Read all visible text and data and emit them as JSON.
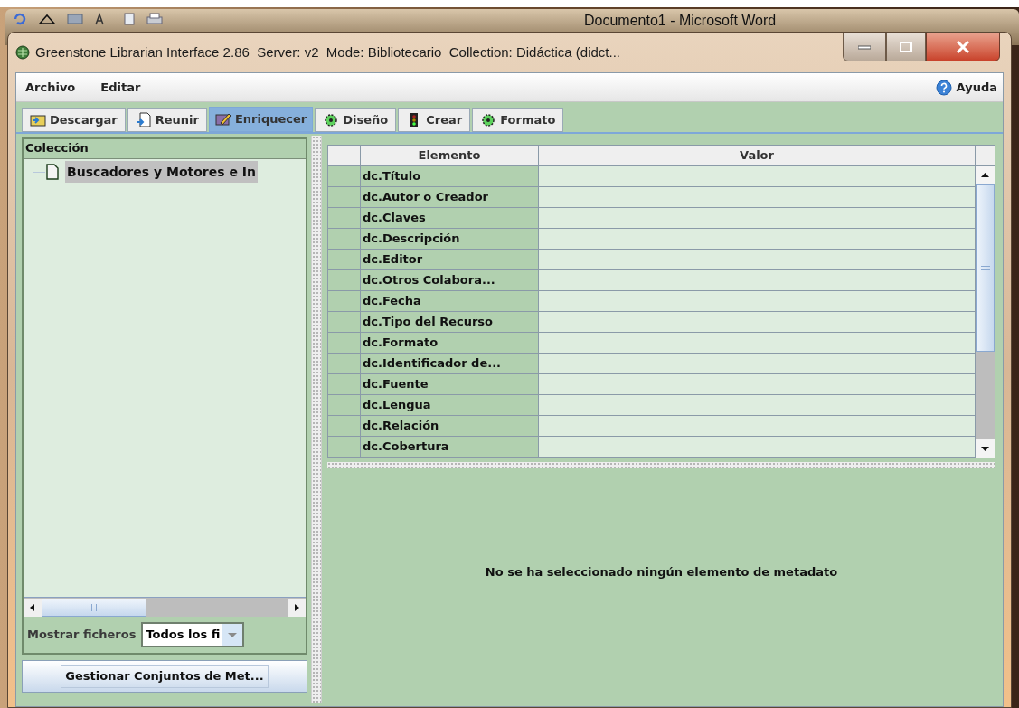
{
  "background_window": {
    "title": "Documento1 - Microsoft Word"
  },
  "window": {
    "title": "Greenstone Librarian Interface 2.86  Server: v2  Mode: Bibliotecario  Collection: Didáctica (didct..."
  },
  "menu": [
    {
      "label": "Archivo"
    },
    {
      "label": "Editar"
    }
  ],
  "help": {
    "label": "Ayuda"
  },
  "tabs": [
    {
      "label": "Descargar",
      "selected": false
    },
    {
      "label": "Reunir",
      "selected": false
    },
    {
      "label": "Enriquecer",
      "selected": true
    },
    {
      "label": "Diseño",
      "selected": false
    },
    {
      "label": "Crear",
      "selected": false
    },
    {
      "label": "Formato",
      "selected": false
    }
  ],
  "collection_tree": {
    "header": "Colección",
    "items": [
      {
        "label": "Buscadores y Motores e In",
        "selected": true
      }
    ]
  },
  "file_filter": {
    "label": "Mostrar ficheros",
    "value": "Todos los fi"
  },
  "manage_button": {
    "label": "Gestionar Conjuntos de Met..."
  },
  "metadata_table": {
    "columns": [
      "Elemento",
      "Valor"
    ],
    "rows": [
      {
        "element": "dc.Título"
      },
      {
        "element": "dc.Autor o Creador"
      },
      {
        "element": "dc.Claves"
      },
      {
        "element": "dc.Descripción"
      },
      {
        "element": "dc.Editor"
      },
      {
        "element": "dc.Otros Colabora..."
      },
      {
        "element": "dc.Fecha"
      },
      {
        "element": "dc.Tipo del Recurso"
      },
      {
        "element": "dc.Formato"
      },
      {
        "element": "dc.Identificador de..."
      },
      {
        "element": "dc.Fuente"
      },
      {
        "element": "dc.Lengua"
      },
      {
        "element": "dc.Relación"
      },
      {
        "element": "dc.Cobertura"
      }
    ]
  },
  "message": "No se ha seleccionado ningún elemento de metadato"
}
